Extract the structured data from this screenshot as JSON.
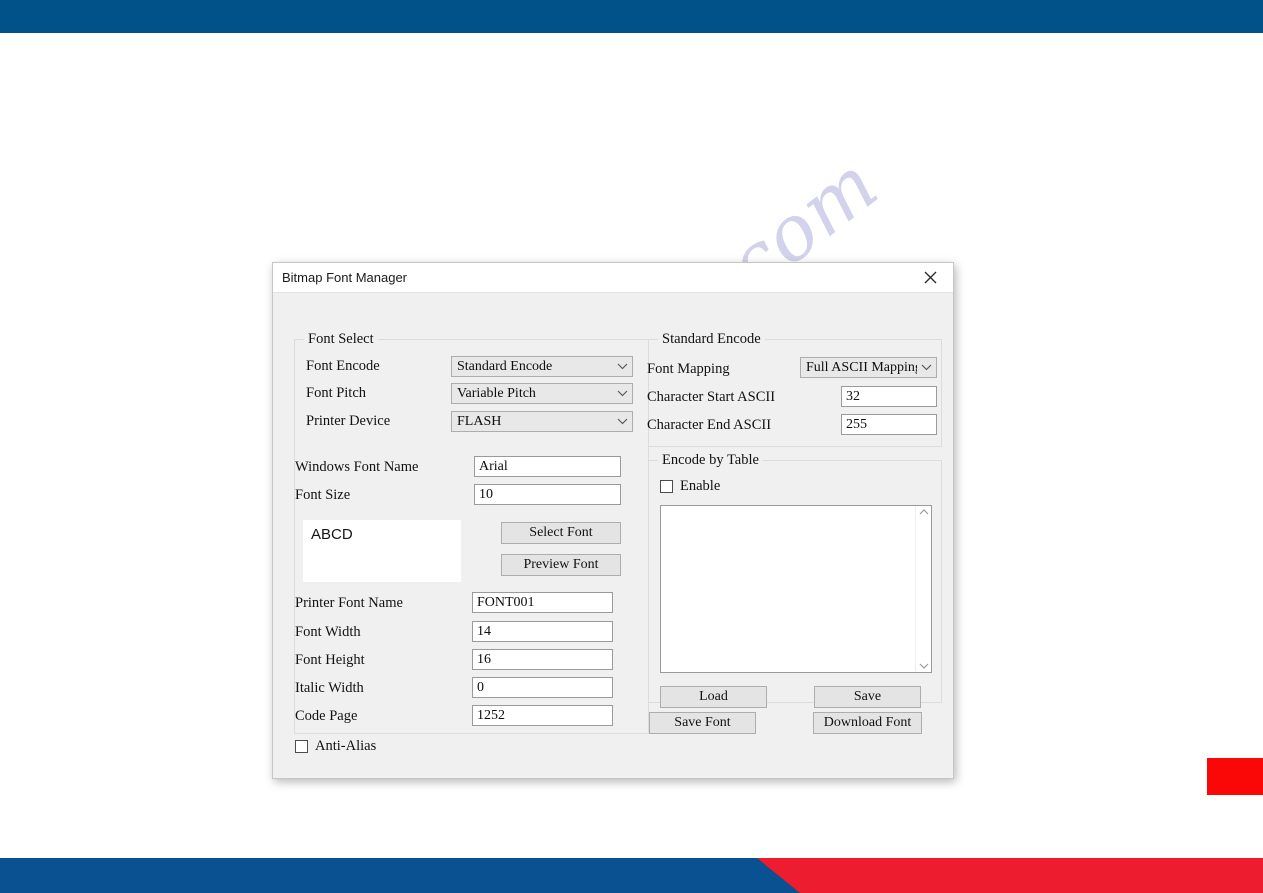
{
  "page": {
    "watermark_text": "manualshive.com",
    "banner_color_top": "#005289",
    "banner_color_bottom_left": "#0a5192",
    "banner_color_bottom_right": "#ed1c2e",
    "accent_tab_color": "#fa0707"
  },
  "dialog": {
    "title": "Bitmap Font Manager",
    "close_label": "close-icon"
  },
  "font_select": {
    "group_title": "Font Select",
    "font_encode": {
      "label": "Font Encode",
      "value": "Standard Encode"
    },
    "font_pitch": {
      "label": "Font Pitch",
      "value": "Variable Pitch"
    },
    "printer_device": {
      "label": "Printer Device",
      "value": "FLASH"
    },
    "windows_font_name": {
      "label": "Windows Font Name",
      "value": "Arial"
    },
    "font_size": {
      "label": "Font Size",
      "value": "10"
    },
    "preview_sample": "ABCD",
    "select_font_button": "Select Font",
    "preview_font_button": "Preview Font",
    "printer_font_name": {
      "label": "Printer Font Name",
      "value": "FONT001"
    },
    "font_width": {
      "label": "Font Width",
      "value": "14"
    },
    "font_height": {
      "label": "Font Height",
      "value": "16"
    },
    "italic_width": {
      "label": "Italic Width",
      "value": "0"
    },
    "code_page": {
      "label": "Code Page",
      "value": "1252"
    },
    "anti_alias": {
      "label": "Anti-Alias",
      "checked": false
    }
  },
  "standard_encode": {
    "group_title": "Standard Encode",
    "font_mapping": {
      "label": "Font Mapping",
      "value": "Full ASCII Mapping"
    },
    "character_start_ascii": {
      "label": "Character Start ASCII",
      "value": "32"
    },
    "character_end_ascii": {
      "label": "Character End ASCII",
      "value": "255"
    }
  },
  "encode_by_table": {
    "group_title": "Encode by Table",
    "enable": {
      "label": "Enable",
      "checked": false
    },
    "table_value": "",
    "load_button": "Load",
    "save_button": "Save"
  },
  "actions": {
    "save_font_button": "Save Font",
    "download_font_button": "Download Font"
  }
}
